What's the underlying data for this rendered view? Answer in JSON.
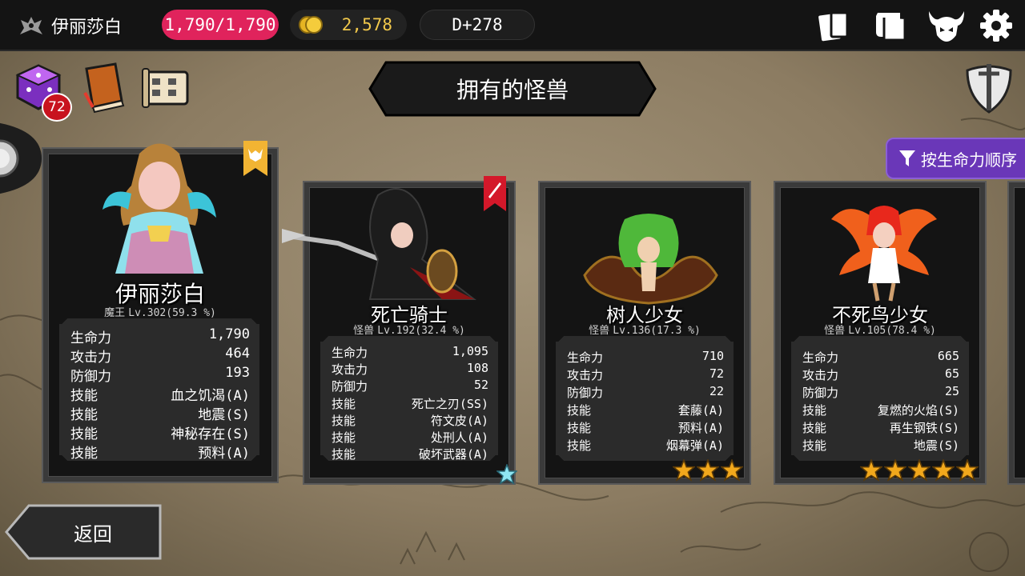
{
  "header": {
    "player_name": "伊丽莎白",
    "hp": "1,790/1,790",
    "gold": "2,578",
    "day": "D+278"
  },
  "left_icons": {
    "dice_badge": "72"
  },
  "title": "拥有的怪兽",
  "sort_label": "按生命力顺序",
  "back_label": "返回",
  "cards": [
    {
      "name": "伊丽莎白",
      "class": "魔王",
      "level": "Lv.302(59.3 %)",
      "stats": [
        [
          "生命力",
          "1,790"
        ],
        [
          "攻击力",
          "464"
        ],
        [
          "防御力",
          "193"
        ],
        [
          "技能",
          "血之饥渴(A)"
        ],
        [
          "技能",
          "地震(S)"
        ],
        [
          "技能",
          "神秘存在(S)"
        ],
        [
          "技能",
          "预料(A)"
        ]
      ],
      "stars": 0
    },
    {
      "name": "死亡骑士",
      "class": "怪兽",
      "level": "Lv.192(32.4 %)",
      "stats": [
        [
          "生命力",
          "1,095"
        ],
        [
          "攻击力",
          "108"
        ],
        [
          "防御力",
          "52"
        ],
        [
          "技能",
          "死亡之刃(SS)"
        ],
        [
          "技能",
          "符文皮(A)"
        ],
        [
          "技能",
          "处刑人(A)"
        ],
        [
          "技能",
          "破坏武器(A)"
        ]
      ],
      "stars": 0
    },
    {
      "name": "树人少女",
      "class": "怪兽",
      "level": "Lv.136(17.3 %)",
      "stats": [
        [
          "生命力",
          "710"
        ],
        [
          "攻击力",
          "72"
        ],
        [
          "防御力",
          "22"
        ],
        [
          "技能",
          "套藤(A)"
        ],
        [
          "技能",
          "预料(A)"
        ],
        [
          "技能",
          "烟幕弹(A)"
        ]
      ],
      "stars": 3
    },
    {
      "name": "不死鸟少女",
      "class": "怪兽",
      "level": "Lv.105(78.4 %)",
      "stats": [
        [
          "生命力",
          "665"
        ],
        [
          "攻击力",
          "65"
        ],
        [
          "防御力",
          "25"
        ],
        [
          "技能",
          "复燃的火焰(S)"
        ],
        [
          "技能",
          "再生钢铁(S)"
        ],
        [
          "技能",
          "地震(S)"
        ]
      ],
      "stars": 5
    }
  ],
  "colors": {
    "hp_pill": "#e0235c",
    "gold_text": "#f1c84b",
    "sort_button": "#6a37b8",
    "badge": "#c8131e",
    "star": "#f2a81c"
  }
}
